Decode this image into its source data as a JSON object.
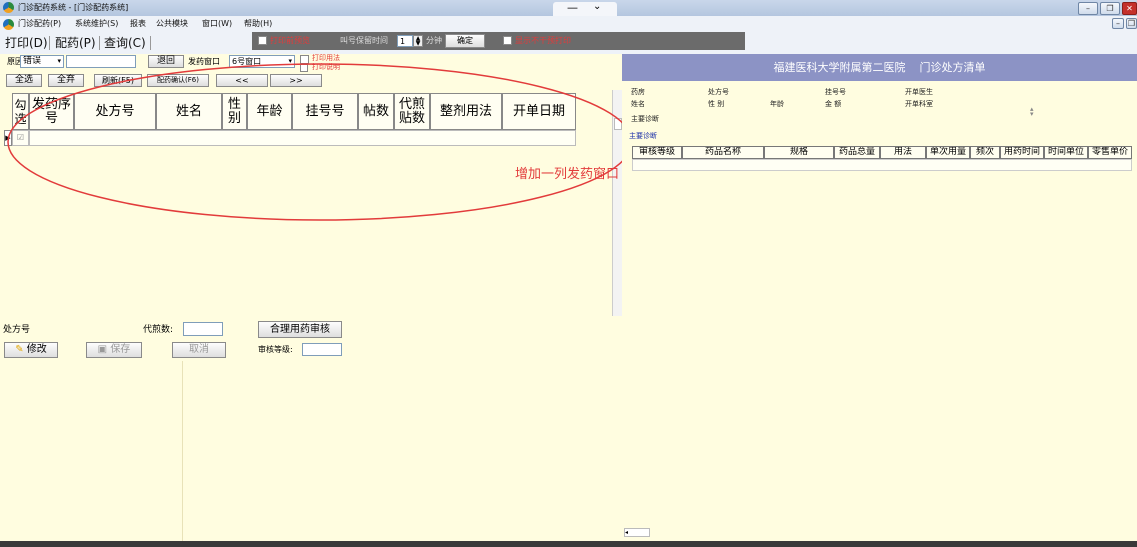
{
  "window": {
    "title": "门诊配药系统 - [门诊配药系统]"
  },
  "menu": [
    "门诊配药(P)",
    "系统维护(S)",
    "报表",
    "公共模块",
    "窗口(W)",
    "帮助(H)"
  ],
  "tabs": [
    "打印(D)",
    "配药(P)",
    "查询(C)"
  ],
  "toolbar": {
    "print_preview": "打印前预览",
    "call_keep_label": "叫号保留时间",
    "call_keep_value": "1",
    "minutes": "分钟",
    "confirm": "确定",
    "show_no_print": "显示不干预打印"
  },
  "filters": {
    "reason_label": "原因",
    "reason_value": "错误",
    "return": "退回",
    "window_label": "发药窗口",
    "window_value": "6号窗口",
    "print_usage": "打印用法",
    "print_notes": "打印说明",
    "select_all": "全选",
    "discard": "全弃",
    "refresh": "刷新(F5)",
    "confirm_dispense": "配药确认(F6)",
    "prev": "<<",
    "next": ">>"
  },
  "grid": {
    "columns": [
      "勾选",
      "发药序号",
      "处方号",
      "姓名",
      "性别",
      "年龄",
      "挂号号",
      "帖数",
      "代煎贴数",
      "整剂用法",
      "开单日期"
    ],
    "row_check": "☑"
  },
  "annotation": "增加一列发药窗口",
  "bottom": {
    "rx_label": "处方号",
    "decoct_label": "代煎数:",
    "audit_button": "合理用药审核",
    "audit_level_label": "审核等级:",
    "edit": "修改",
    "save": "保存",
    "cancel": "取消"
  },
  "right": {
    "hospital": "福建医科大学附属第二医院",
    "title": "门诊处方清单",
    "pharmacy": "药房",
    "rx_no": "处方号",
    "reg_no": "挂号号",
    "doctor": "开单医生",
    "name": "姓名",
    "sex": "性 别",
    "age": "年龄",
    "amount": "金 额",
    "dept": "开单科室",
    "diag1": "主要诊断",
    "diag2": "主要诊断",
    "columns": [
      "审核等级",
      "药品名称",
      "规格",
      "药品总量",
      "用法",
      "单次用量",
      "频次",
      "用药时间",
      "时间单位",
      "零售单价"
    ]
  },
  "colors": {
    "header_bg": "#8c93c5",
    "panel_bg": "#fffde0",
    "annotation": "#e23b3b"
  }
}
